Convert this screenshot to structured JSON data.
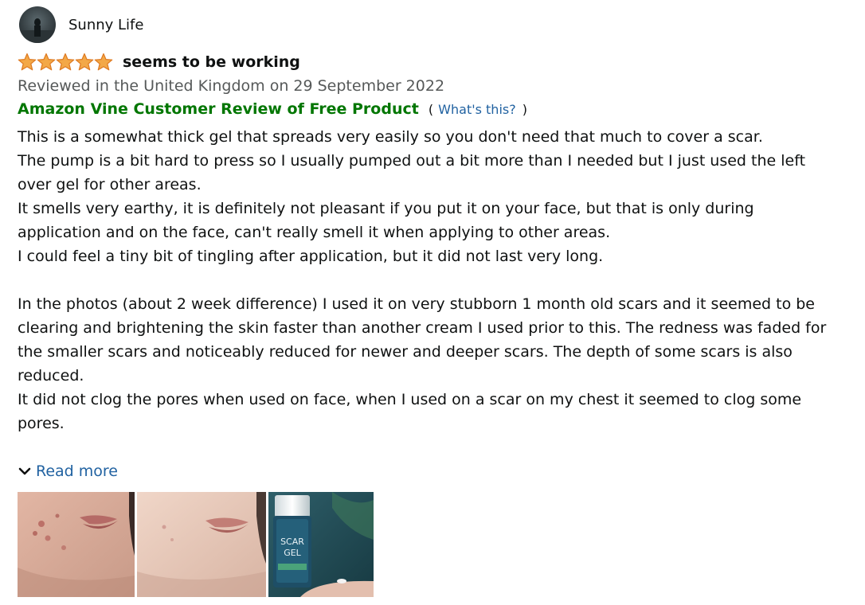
{
  "reviewer": {
    "name": "Sunny Life",
    "avatar_icon": "profile-avatar"
  },
  "review": {
    "rating": 5,
    "rating_max": 5,
    "star_color": "#f3a847",
    "title": "seems to be working",
    "date_line": "Reviewed in the United Kingdom on 29 September 2022",
    "vine_label": "Amazon Vine Customer Review of Free Product",
    "whats_open": "(",
    "whats_link": "What's this?",
    "whats_close": ")",
    "paragraphs": [
      "This is a somewhat thick gel that spreads very easily so you don't need that much to cover a scar.",
      "The pump is a bit hard to press so I usually pumped out a bit more than I needed but I just used the left over gel for other areas.",
      "It smells very earthy, it is definitely not pleasant if you put it on your face, but that is only during application and on the face, can't really smell it when applying to other areas.",
      "I could feel a tiny bit of tingling after application, but it did not last very long.",
      "",
      "In the photos (about 2 week difference) I used it on very stubborn 1 month old scars and it seemed to be clearing and brightening the skin faster than another cream I used prior to this. The redness was faded for the smaller scars and noticeably reduced for newer and deeper scars. The depth of some scars is also reduced.",
      "It did not clog the pores when used on face, when I used on a scar on my chest it seemed to clog some pores."
    ],
    "read_more": "Read more",
    "read_more_icon": "chevron-down-icon",
    "images": [
      {
        "name": "review-photo-before"
      },
      {
        "name": "review-photo-after"
      },
      {
        "name": "review-photo-product",
        "label_line1": "SCAR",
        "label_line2": "GEL"
      }
    ]
  },
  "colors": {
    "vine_green": "#007600",
    "link_blue": "#2162a1",
    "secondary_text": "#565959"
  }
}
